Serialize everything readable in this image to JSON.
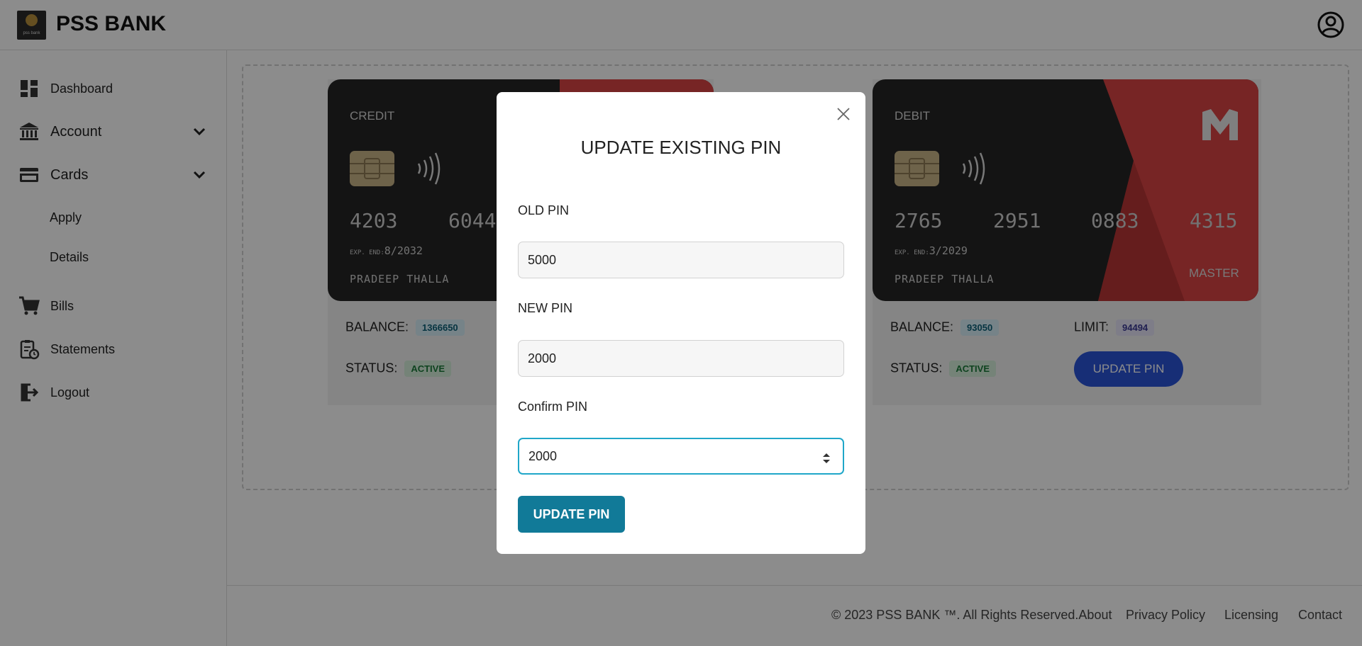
{
  "header": {
    "brand": "PSS BANK",
    "logo_text": "pss bank"
  },
  "sidebar": {
    "items": [
      {
        "label": "Dashboard",
        "icon": "dashboard-icon"
      },
      {
        "label": "Account",
        "icon": "bank-icon"
      },
      {
        "label": "Cards",
        "icon": "card-icon"
      },
      {
        "label": "Bills",
        "icon": "cart-icon"
      },
      {
        "label": "Statements",
        "icon": "clipboard-clock-icon"
      },
      {
        "label": "Logout",
        "icon": "logout-icon"
      }
    ],
    "sub_items": [
      "Apply",
      "Details"
    ]
  },
  "credit_card": {
    "type": "CREDIT",
    "number_parts": [
      "4203",
      "6044"
    ],
    "exp_label": "EXP. END:",
    "exp": "8/2032",
    "holder": "PRADEEP THALLA",
    "balance_label": "BALANCE:",
    "balance": "1366650",
    "status_label": "STATUS:",
    "status": "ACTIVE"
  },
  "debit_card": {
    "type": "DEBIT",
    "number_parts": [
      "2765",
      "2951",
      "0883",
      "4315"
    ],
    "exp_label": "EXP. END:",
    "exp": "3/2029",
    "holder": "PRADEEP THALLA",
    "network": "MASTER",
    "balance_label": "BALANCE:",
    "balance": "93050",
    "limit_label": "LIMIT:",
    "limit": "94494",
    "status_label": "STATUS:",
    "status": "ACTIVE",
    "button": "UPDATE PIN"
  },
  "footer": {
    "copyright": "© 2023 PSS BANK ™. All Rights Reserved.",
    "links": [
      "About",
      "Privacy Policy",
      "Licensing",
      "Contact"
    ]
  },
  "modal": {
    "title": "UPDATE EXISTING PIN",
    "old_pin_label": "OLD PIN",
    "old_pin_value": "5000",
    "new_pin_label": "NEW PIN",
    "new_pin_value": "2000",
    "confirm_pin_label": "Confirm PIN",
    "confirm_pin_value": "2000",
    "submit": "UPDATE PIN"
  },
  "colors": {
    "accent": "#117a98",
    "focus": "#20a7c9",
    "card_dark": "#262626",
    "card_red": "#d94444",
    "pin_button": "#2b54d8"
  }
}
